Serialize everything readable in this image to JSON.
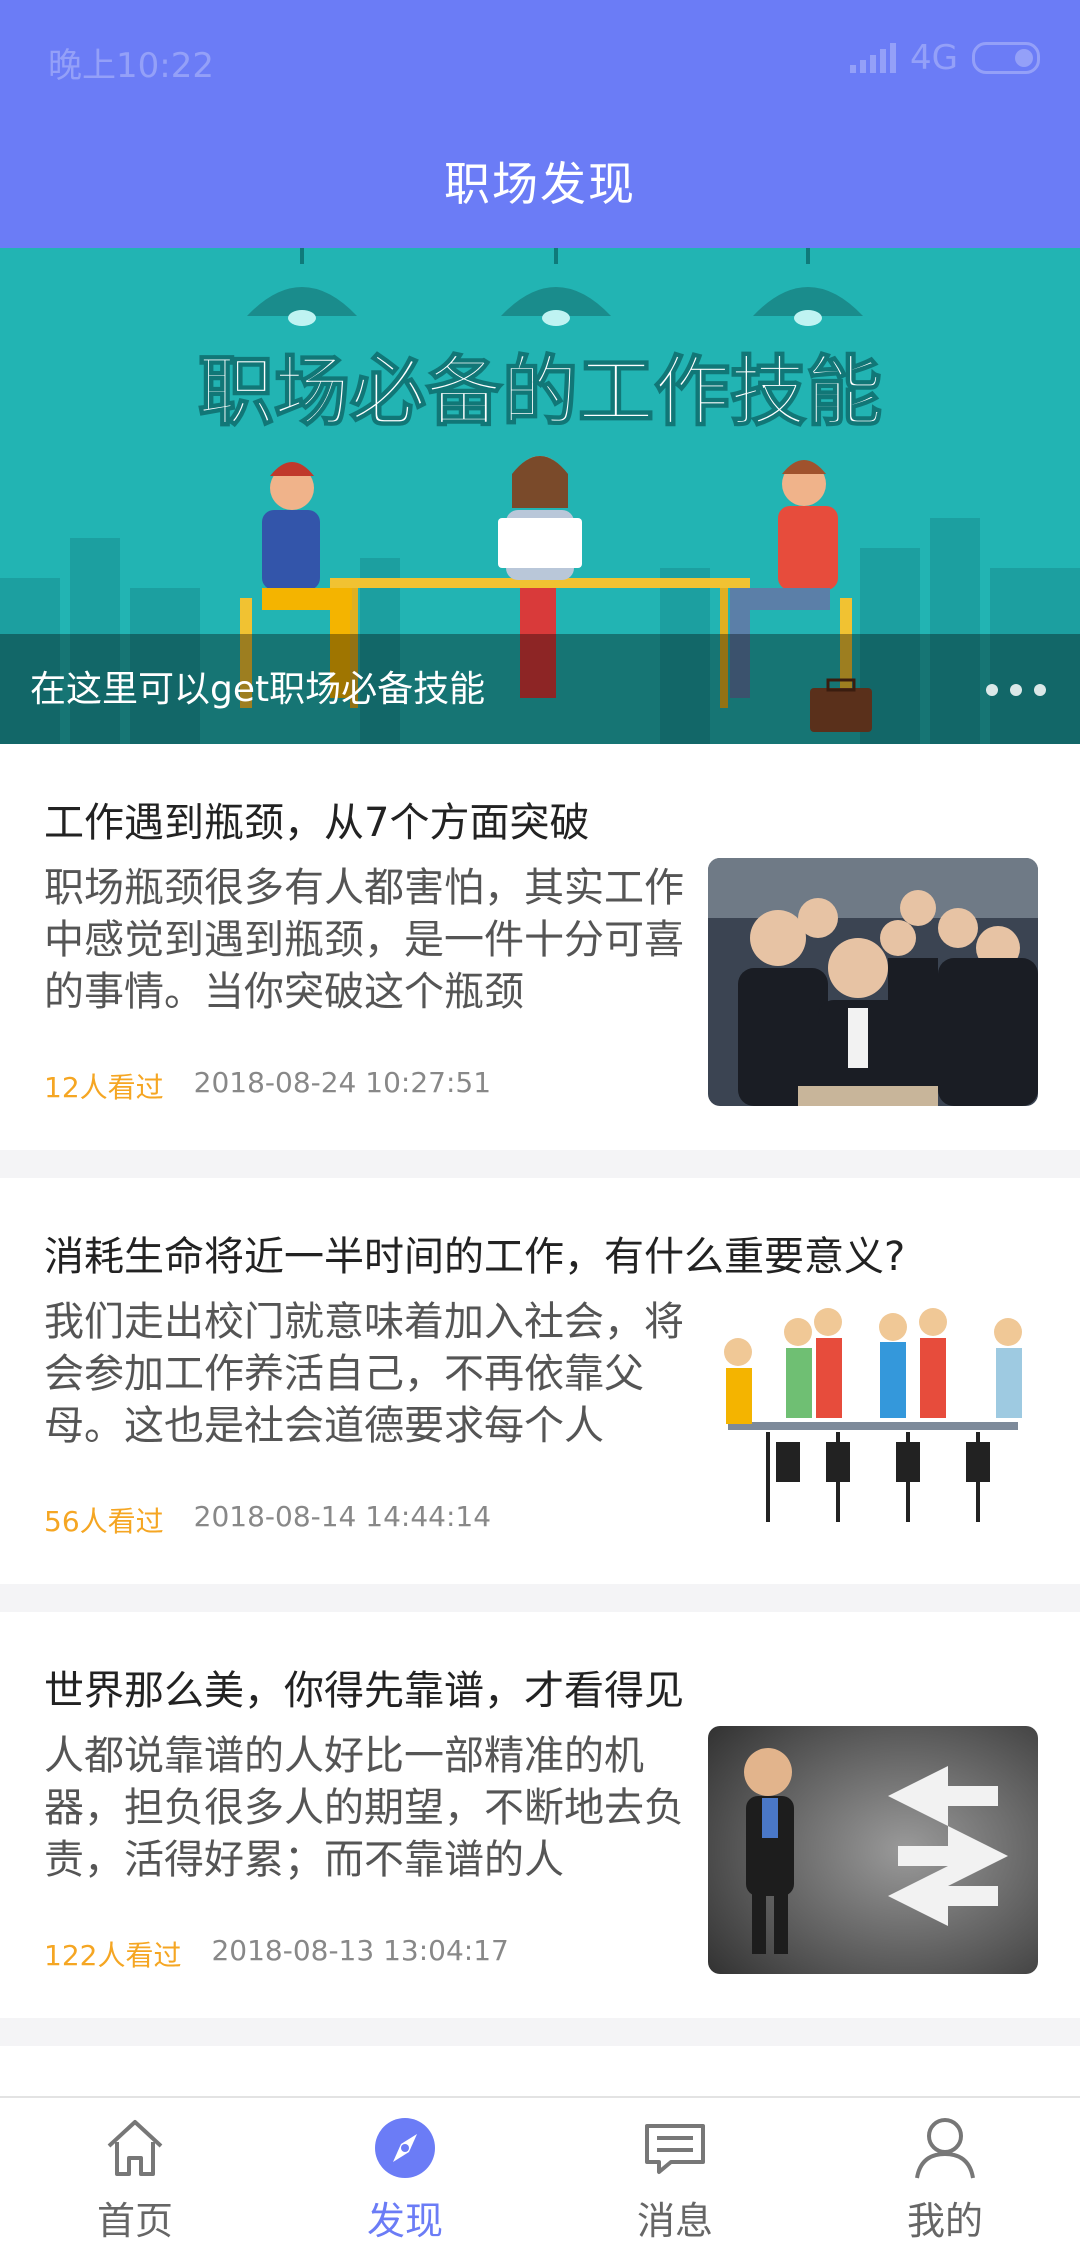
{
  "status_bar": {
    "time": "晚上10:22",
    "network": "4G"
  },
  "header": {
    "title": "职场发现"
  },
  "banner": {
    "headline": "职场必备的工作技能",
    "caption": "在这里可以get职场必备技能"
  },
  "articles": [
    {
      "title": "工作遇到瓶颈，从7个方面突破",
      "summary": "职场瓶颈很多有人都害怕，其实工作中感觉到遇到瓶颈，是一件十分可喜的事情。当你突破这个瓶颈",
      "views": "12人看过",
      "date": "2018-08-24 10:27:51"
    },
    {
      "title": "消耗生命将近一半时间的工作，有什么重要意义?",
      "summary": "我们走出校门就意味着加入社会，将会参加工作养活自己，不再依靠父母。这也是社会道德要求每个人",
      "views": "56人看过",
      "date": "2018-08-14 14:44:14"
    },
    {
      "title": "世界那么美，你得先靠谱，才看得见",
      "summary": "人都说靠谱的人好比一部精准的机器，担负很多人的期望，不断地去负责，活得好累；而不靠谱的人",
      "views": "122人看过",
      "date": "2018-08-13 13:04:17"
    }
  ],
  "bottom_nav": [
    {
      "label": "首页",
      "icon": "home-icon"
    },
    {
      "label": "发现",
      "icon": "compass-icon",
      "active": true
    },
    {
      "label": "消息",
      "icon": "message-icon"
    },
    {
      "label": "我的",
      "icon": "user-icon"
    }
  ],
  "colors": {
    "accent": "#6b7cf6",
    "views": "#f5a623",
    "banner_bg": "#22b4b3"
  }
}
